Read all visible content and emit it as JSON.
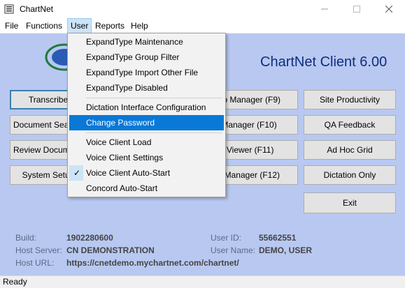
{
  "window": {
    "title": "ChartNet"
  },
  "menubar": {
    "items": [
      {
        "label": "File"
      },
      {
        "label": "Functions"
      },
      {
        "label": "User"
      },
      {
        "label": "Reports"
      },
      {
        "label": "Help"
      }
    ]
  },
  "header": {
    "product_title": "ChartNet Client 6.00"
  },
  "buttons": {
    "transcribe": "Transcribe",
    "document_search": "Document Search",
    "review_documents": "Review Documents",
    "system_setup": "System Setup",
    "distrib_manager": "Distrib Manager (F9)",
    "qa_manager": "QA Manager (F10)",
    "log_viewer": "Log Viewer (F11)",
    "user_manager": "User Manager (F12)",
    "site_productivity": "Site Productivity",
    "qa_feedback": "QA Feedback",
    "ad_hoc_grid": "Ad Hoc Grid",
    "dictation_only": "Dictation Only",
    "exit": "Exit"
  },
  "info": {
    "build_label": "Build:",
    "build_value": "1902280600",
    "host_server_label": "Host Server:",
    "host_server_value": "CN DEMONSTRATION",
    "host_url_label": "Host URL:",
    "host_url_value": "https://cnetdemo.mychartnet.com/chartnet/",
    "user_id_label": "User ID:",
    "user_id_value": "55662551",
    "user_name_label": "User Name:",
    "user_name_value": "DEMO, USER"
  },
  "user_menu": {
    "items": [
      {
        "label": "ExpandType Maintenance"
      },
      {
        "label": "ExpandType Group Filter"
      },
      {
        "label": "ExpandType Import Other File"
      },
      {
        "label": "ExpandType Disabled"
      },
      {
        "label": "Dictation Interface Configuration"
      },
      {
        "label": "Change Password",
        "highlighted": true
      },
      {
        "label": "Voice Client Load"
      },
      {
        "label": "Voice Client Settings"
      },
      {
        "label": "Voice Client Auto-Start",
        "checked": true
      },
      {
        "label": "Concord Auto-Start"
      }
    ]
  },
  "status": {
    "text": "Ready"
  },
  "colors": {
    "client_bg": "#b8c8f0",
    "title_blue": "#0e2d7e",
    "highlight": "#0a78d7"
  }
}
